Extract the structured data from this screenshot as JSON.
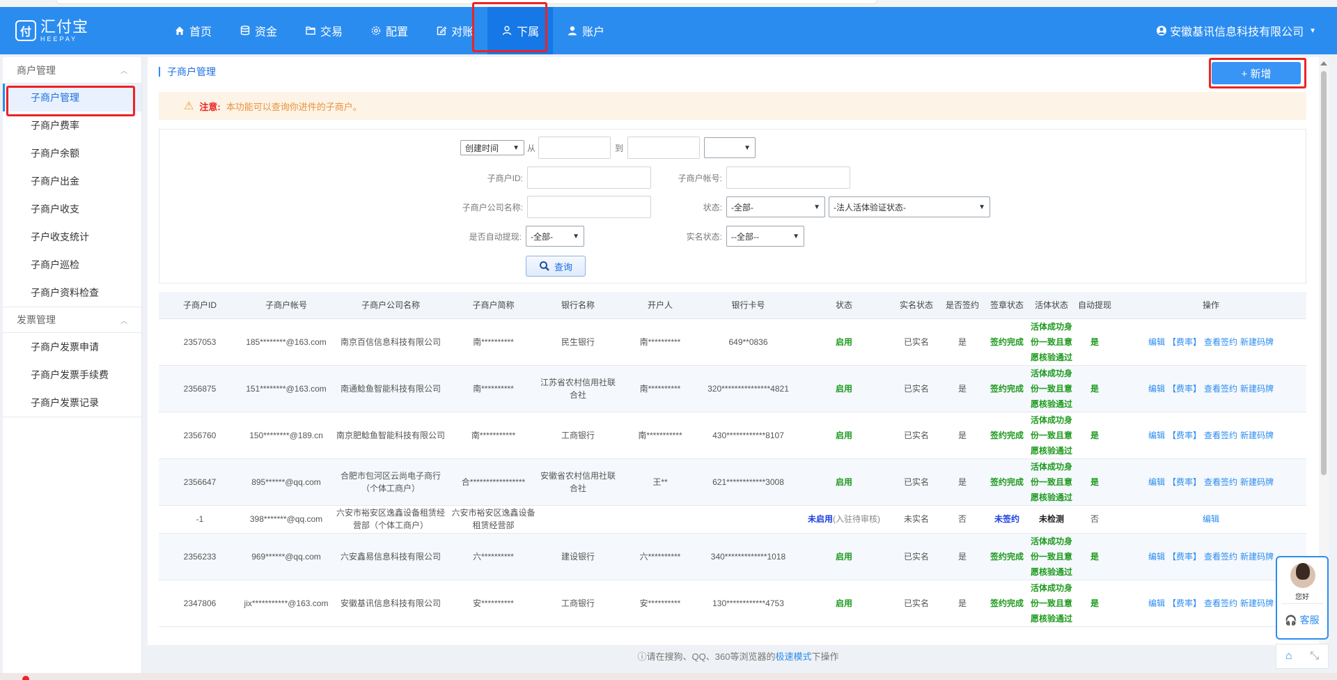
{
  "logo": {
    "mark": "付",
    "cn": "汇付宝",
    "en": "HEEPAY"
  },
  "nav": [
    {
      "label": "首页",
      "icon": "home-icon"
    },
    {
      "label": "资金",
      "icon": "database-icon"
    },
    {
      "label": "交易",
      "icon": "folder-icon"
    },
    {
      "label": "配置",
      "icon": "gear-icon"
    },
    {
      "label": "对账",
      "icon": "edit-icon"
    },
    {
      "label": "下属",
      "icon": "user-outline-icon",
      "active": true
    },
    {
      "label": "账户",
      "icon": "user-icon"
    }
  ],
  "company": "安徽基讯信息科技有限公司",
  "sidebar": {
    "groups": [
      {
        "title": "商户管理",
        "items": [
          "子商户管理",
          "子商户费率",
          "子商户余额",
          "子商户出金",
          "子商户收支",
          "子户收支统计",
          "子商户巡检",
          "子商户资料检查"
        ]
      },
      {
        "title": "发票管理",
        "items": [
          "子商户发票申请",
          "子商户发票手续费",
          "子商户发票记录"
        ]
      }
    ]
  },
  "page": {
    "title": "子商户管理",
    "add_label": "+ 新增"
  },
  "notice": {
    "label": "注意:",
    "text": "本功能可以查询你进件的子商户。"
  },
  "filter": {
    "date_type": "创建时间",
    "from_label": "从",
    "to_label": "到",
    "id_label": "子商户ID:",
    "account_label": "子商户帐号:",
    "company_label": "子商户公司名称:",
    "status_label": "状态:",
    "status_value": "-全部-",
    "liveness_value": "-法人活体验证状态-",
    "auto_label": "是否自动提现:",
    "auto_value": "-全部-",
    "realname_label": "实名状态:",
    "realname_value": "--全部--",
    "query_label": "查询"
  },
  "table": {
    "headers": [
      "子商户ID",
      "子商户帐号",
      "子商户公司名称",
      "子商户简称",
      "银行名称",
      "开户人",
      "银行卡号",
      "状态",
      "实名状态",
      "是否签约",
      "签章状态",
      "活体状态",
      "自动提现",
      "操作"
    ],
    "rows": [
      {
        "id": "2357053",
        "account": "185********@163.com",
        "company": "南京百信信息科技有限公司",
        "short": "南**********",
        "bank": "民生银行",
        "holder": "南**********",
        "card": "649**0836",
        "status": "启用",
        "status_note": "",
        "realname": "已实名",
        "signed": "是",
        "seal": "签约完成",
        "live": "活体成功身份一致且意愿核验通过",
        "auto": "是",
        "ops": [
          "编辑",
          "【费率】",
          "查看签约",
          "新建码牌"
        ]
      },
      {
        "id": "2356875",
        "account": "151********@163.com",
        "company": "南通鲶鱼智能科技有限公司",
        "short": "南**********",
        "bank": "江苏省农村信用社联合社",
        "holder": "南**********",
        "card": "320***************4821",
        "status": "启用",
        "status_note": "",
        "realname": "已实名",
        "signed": "是",
        "seal": "签约完成",
        "live": "活体成功身份一致且意愿核验通过",
        "auto": "是",
        "ops": [
          "编辑",
          "【费率】",
          "查看签约",
          "新建码牌"
        ]
      },
      {
        "id": "2356760",
        "account": "150********@189.cn",
        "company": "南京肥鲶鱼智能科技有限公司",
        "short": "南***********",
        "bank": "工商银行",
        "holder": "南***********",
        "card": "430************8107",
        "status": "启用",
        "status_note": "",
        "realname": "已实名",
        "signed": "是",
        "seal": "签约完成",
        "live": "活体成功身份一致且意愿核验通过",
        "auto": "是",
        "ops": [
          "编辑",
          "【费率】",
          "查看签约",
          "新建码牌"
        ]
      },
      {
        "id": "2356647",
        "account": "895******@qq.com",
        "company": "合肥市包河区云尚电子商行（个体工商户）",
        "short": "合*****************",
        "bank": "安徽省农村信用社联合社",
        "holder": "王**",
        "card": "621************3008",
        "status": "启用",
        "status_note": "",
        "realname": "已实名",
        "signed": "是",
        "seal": "签约完成",
        "live": "活体成功身份一致且意愿核验通过",
        "auto": "是",
        "ops": [
          "编辑",
          "【费率】",
          "查看签约",
          "新建码牌"
        ]
      },
      {
        "id": "-1",
        "account": "398*******@qq.com",
        "company": "六安市裕安区逸鑫设备租赁经营部（个体工商户）",
        "short": "六安市裕安区逸鑫设备租赁经营部",
        "bank": "",
        "holder": "",
        "card": "",
        "status": "未启用",
        "status_note": "(入驻待审核)",
        "realname": "未实名",
        "signed": "否",
        "seal": "未签约",
        "live": "未检测",
        "auto": "否",
        "ops": [
          "编辑"
        ]
      },
      {
        "id": "2356233",
        "account": "969******@qq.com",
        "company": "六安鑫易信息科技有限公司",
        "short": "六**********",
        "bank": "建设银行",
        "holder": "六**********",
        "card": "340*************1018",
        "status": "启用",
        "status_note": "",
        "realname": "已实名",
        "signed": "是",
        "seal": "签约完成",
        "live": "活体成功身份一致且意愿核验通过",
        "auto": "是",
        "ops": [
          "编辑",
          "【费率】",
          "查看签约",
          "新建码牌"
        ]
      },
      {
        "id": "2347806",
        "account": "jix***********@163.com",
        "company": "安徽基讯信息科技有限公司",
        "short": "安**********",
        "bank": "工商银行",
        "holder": "安**********",
        "card": "130************4753",
        "status": "启用",
        "status_note": "",
        "realname": "已实名",
        "signed": "是",
        "seal": "签约完成",
        "live": "活体成功身份一致且意愿核验通过",
        "auto": "是",
        "ops": [
          "编辑",
          "【费率】",
          "查看签约",
          "新建码牌"
        ]
      }
    ]
  },
  "footer": {
    "pre": "请在搜狗、QQ、360等浏览器的",
    "link": "极速模式",
    "post": "下操作"
  },
  "cs_widget": {
    "hello": "您好",
    "label": "客服"
  },
  "colors": {
    "brand": "#2b8cf0",
    "highlight": "#e22222",
    "success": "#1d9a1d"
  }
}
